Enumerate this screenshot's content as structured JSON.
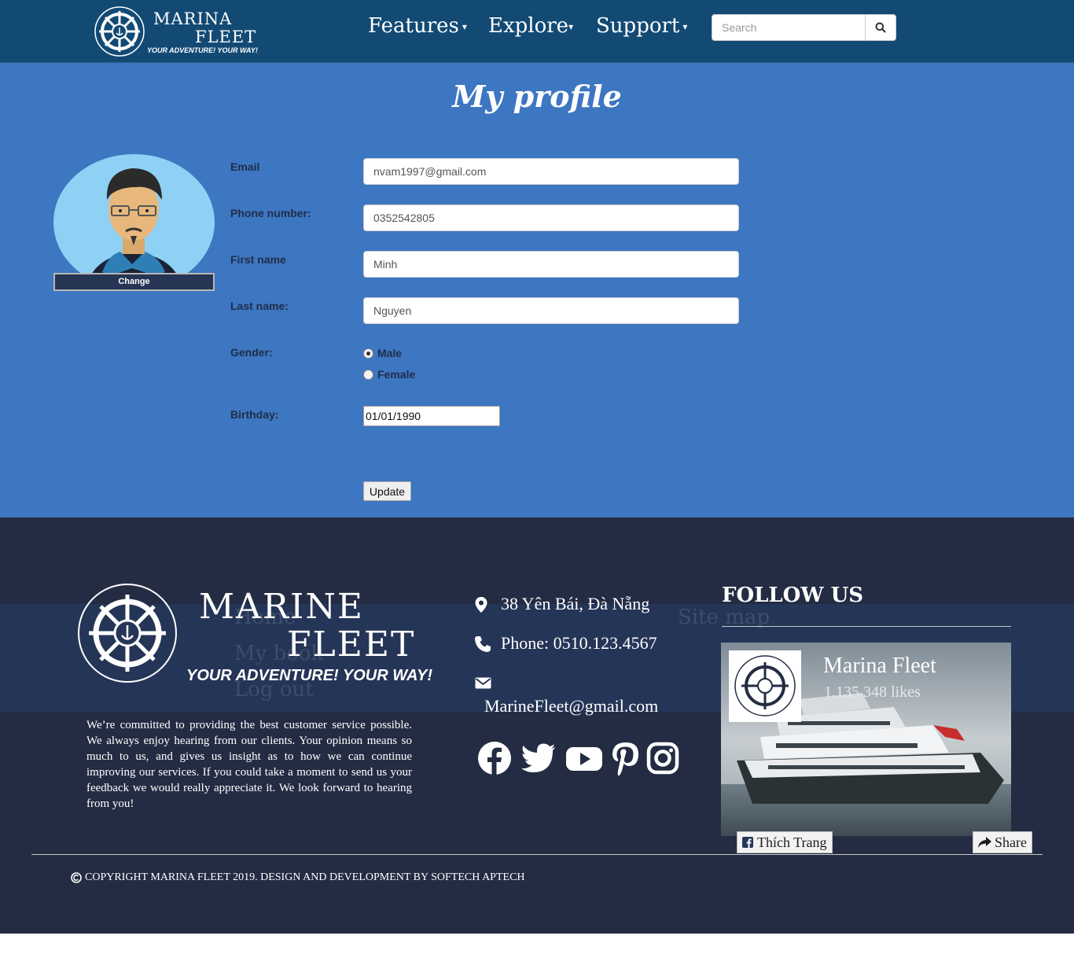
{
  "header": {
    "logo_line1": "MARINA",
    "logo_line2": "FLEET",
    "logo_tagline": "YOUR ADVENTURE! YOUR WAY!",
    "nav": [
      {
        "label": "Features"
      },
      {
        "label": "Explore"
      },
      {
        "label": "Support"
      }
    ],
    "search": {
      "placeholder": "Search",
      "icon": "search-icon"
    }
  },
  "profile": {
    "title": "My profile",
    "avatar_change_label": "Change",
    "labels": {
      "email": "Email",
      "phone": "Phone number:",
      "first_name": "First name",
      "last_name": "Last name:",
      "gender": "Gender:",
      "birthday": "Birthday:"
    },
    "values": {
      "email": "nvam1997@gmail.com",
      "phone": "0352542805",
      "first_name": "Minh",
      "last_name": "Nguyen",
      "birthday": "01/01/1990"
    },
    "gender_options": [
      {
        "label": "Male",
        "checked": true
      },
      {
        "label": "Female",
        "checked": false
      }
    ],
    "update_label": "Update"
  },
  "footer": {
    "logo_line1": "MARINE",
    "logo_line2": "FLEET",
    "logo_tagline": "YOUR ADVENTURE! YOUR WAY!",
    "ghost_menu": [
      "Home",
      "My book",
      "Log out",
      "Site map"
    ],
    "about": "We’re committed to providing the best customer service possible. We always enjoy hearing from our clients. Your opinion means so much to us, and gives us insight as to how we can continue improving our services. If you could take a moment to send us your feedback we would really appreciate it. We look forward to hearing from you!",
    "address": "38 Yên Bái, Đà Nẵng",
    "phone": "Phone: 0510.123.4567",
    "email": "MarineFleet@gmail.com",
    "social_icons": [
      "facebook-icon",
      "twitter-icon",
      "youtube-icon",
      "pinterest-icon",
      "instagram-icon"
    ],
    "follow_title": "FOLLOW US",
    "fb_page_name": "Marina Fleet",
    "fb_likes": "1.135.348 likes",
    "fb_like_label": "Thích Trang",
    "fb_share_label": "Share",
    "copyright": "COPYRIGHT MARINA FLEET 2019. DESIGN AND DEVELOPMENT BY SOFTECH APTECH"
  },
  "colors": {
    "header_bg": "#124a74",
    "main_bg": "#3d76c1",
    "footer_bg": "#232c43"
  }
}
